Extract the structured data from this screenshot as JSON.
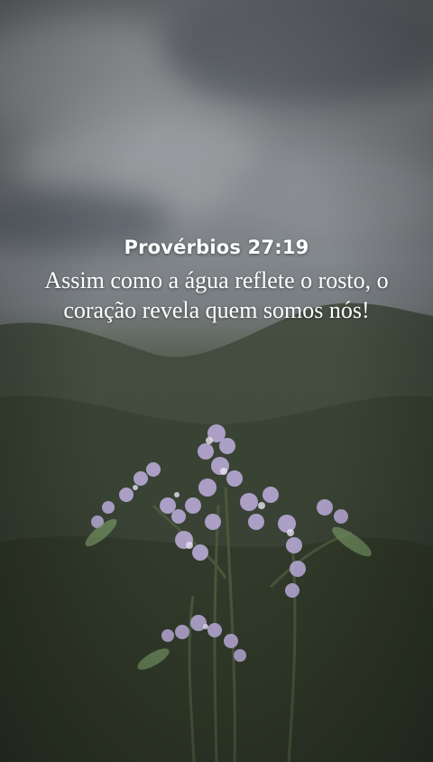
{
  "post": {
    "reference": "Provérbios 27:19",
    "verse": "Assim como a água reflete o rosto, o coração revela quem somos nós!"
  },
  "colors": {
    "sky": "#9a9fa4",
    "hills": "#3f4b3b",
    "flowers": "#b7a8d6",
    "text": "#ffffff"
  }
}
